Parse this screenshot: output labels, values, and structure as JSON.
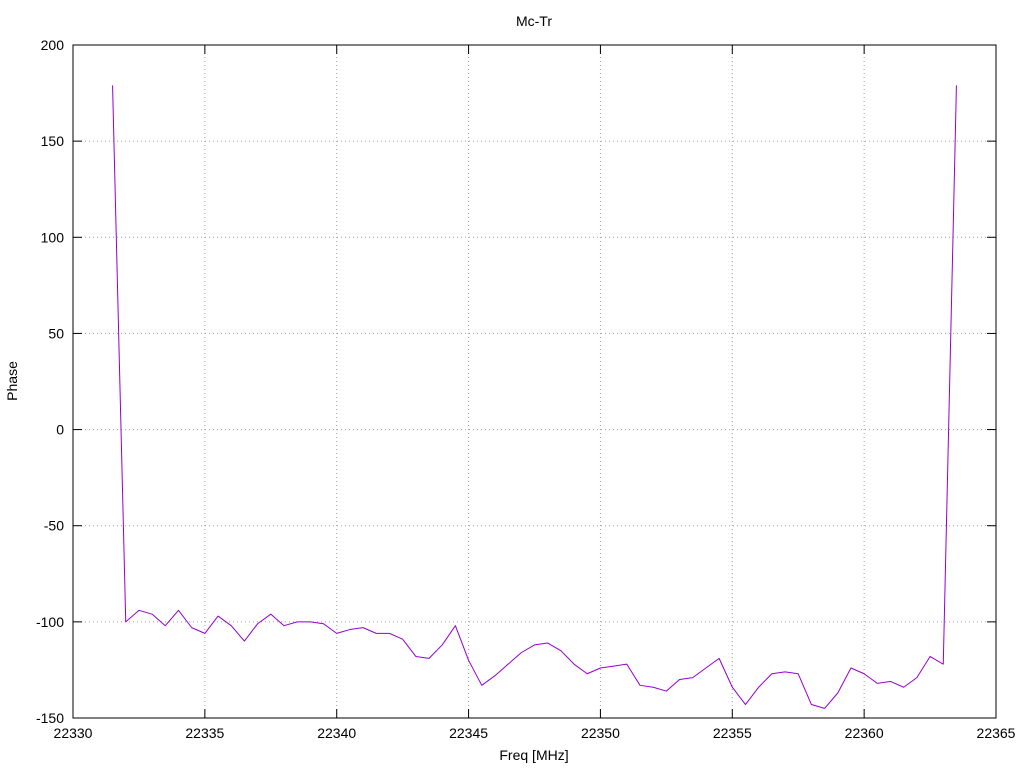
{
  "colors": {
    "series": "#9400d3",
    "grid": "#a0a0a0",
    "frame": "#000000",
    "background": "#ffffff"
  },
  "chart_data": {
    "type": "line",
    "title": "Mc-Tr",
    "xlabel": "Freq [MHz]",
    "ylabel": "Phase",
    "xlim": [
      22330,
      22365
    ],
    "ylim": [
      -150,
      200
    ],
    "xticks": [
      22330,
      22335,
      22340,
      22345,
      22350,
      22355,
      22360,
      22365
    ],
    "yticks": [
      -150,
      -100,
      -50,
      0,
      50,
      100,
      150,
      200
    ],
    "grid": true,
    "legend": "none",
    "series": [
      {
        "x": [
          22331.5,
          22332.0,
          22332.5,
          22333.0,
          22333.5,
          22334.0,
          22334.5,
          22335.0,
          22335.5,
          22336.0,
          22336.5,
          22337.0,
          22337.5,
          22338.0,
          22338.5,
          22339.0,
          22339.5,
          22340.0,
          22340.5,
          22341.0,
          22341.5,
          22342.0,
          22342.5,
          22343.0,
          22343.5,
          22344.0,
          22344.5,
          22345.0,
          22345.5,
          22346.0,
          22346.5,
          22347.0,
          22347.5,
          22348.0,
          22348.5,
          22349.0,
          22349.5,
          22350.0,
          22350.5,
          22351.0,
          22351.5,
          22352.0,
          22352.5,
          22353.0,
          22353.5,
          22354.0,
          22354.5,
          22355.0,
          22355.5,
          22356.0,
          22356.5,
          22357.0,
          22357.5,
          22358.0,
          22358.5,
          22359.0,
          22359.5,
          22360.0,
          22360.5,
          22361.0,
          22361.5,
          22362.0,
          22362.5,
          22363.0,
          22363.5
        ],
        "y": [
          179,
          -100,
          -94,
          -96,
          -102,
          -94,
          -103,
          -106,
          -97,
          -102,
          -110,
          -101,
          -96,
          -102,
          -100,
          -100,
          -101,
          -106,
          -104,
          -103,
          -106,
          -106,
          -109,
          -118,
          -119,
          -112,
          -102,
          -120,
          -133,
          -128,
          -122,
          -116,
          -112,
          -111,
          -115,
          -122,
          -127,
          -124,
          -123,
          -122,
          -133,
          -134,
          -136,
          -130,
          -129,
          -124,
          -119,
          -134,
          -143,
          -134,
          -127,
          -126,
          -127,
          -143,
          -145,
          -137,
          -124,
          -127,
          -132,
          -131,
          -134,
          -129,
          -118,
          -122,
          179
        ]
      }
    ]
  }
}
